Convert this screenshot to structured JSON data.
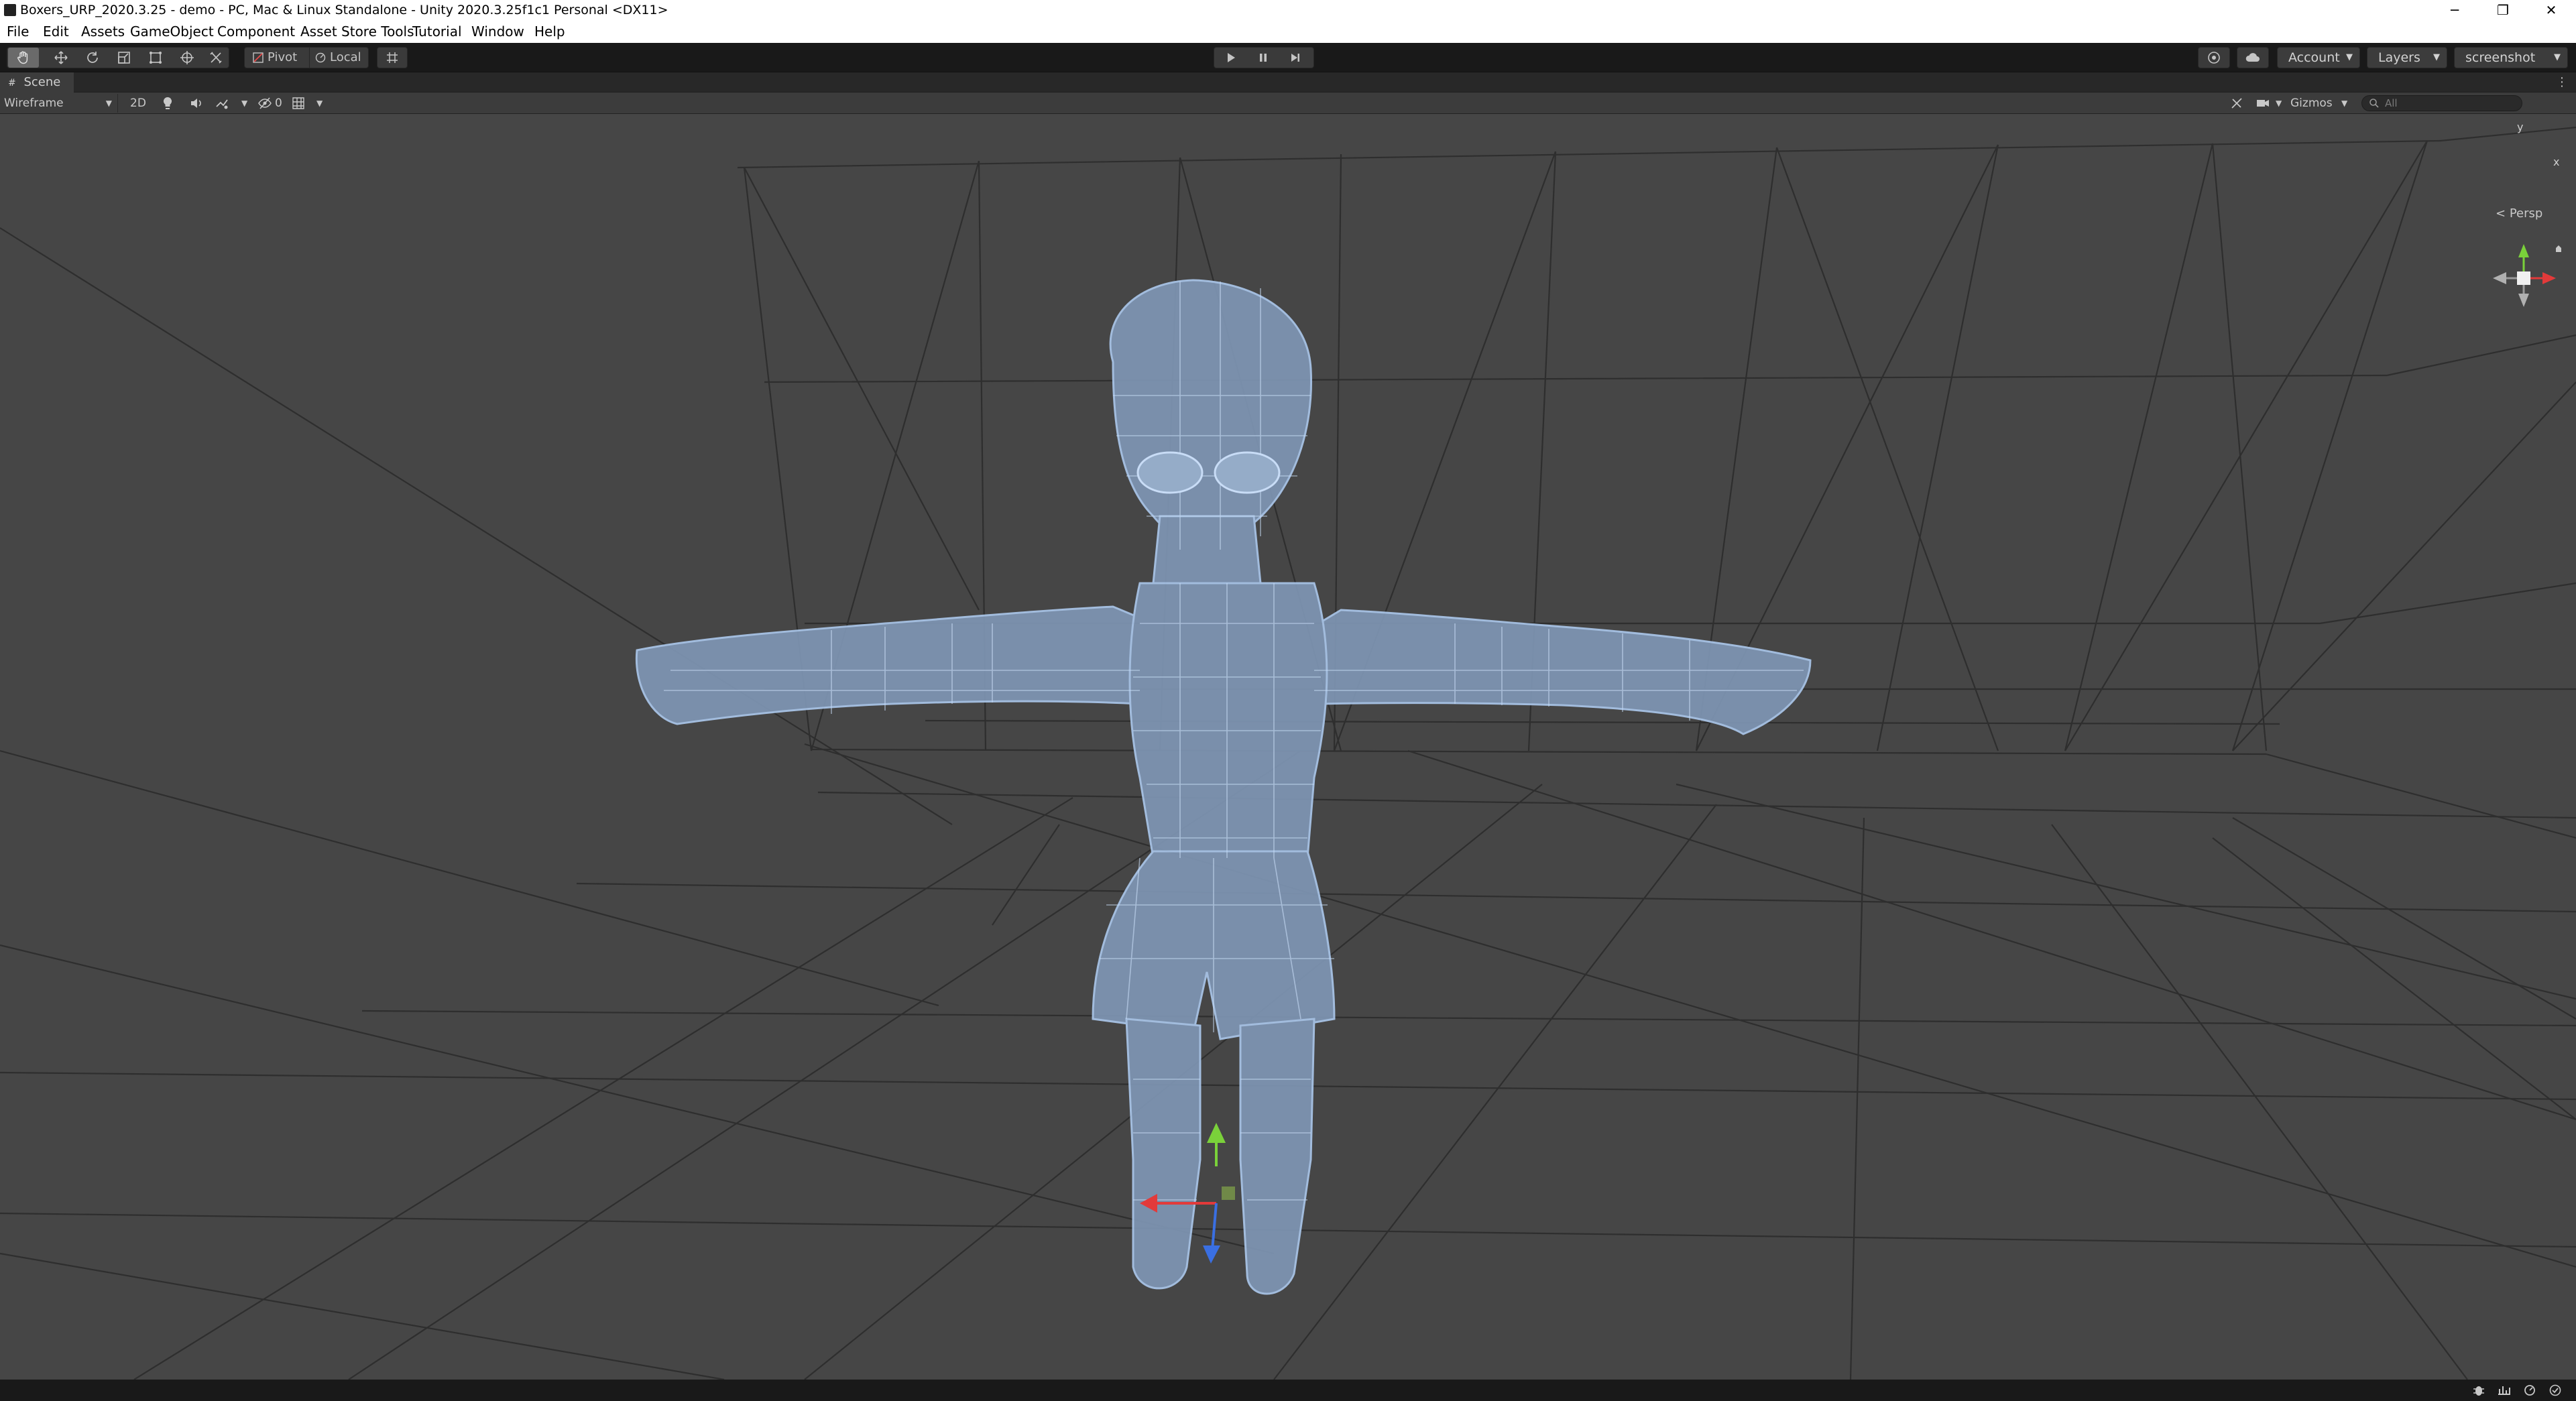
{
  "window": {
    "title": "Boxers_URP_2020.3.25 - demo - PC, Mac & Linux Standalone - Unity 2020.3.25f1c1 Personal <DX11>",
    "controls": {
      "minimize": "─",
      "maximize": "❐",
      "close": "✕"
    }
  },
  "menu": {
    "items": [
      "File",
      "Edit",
      "Assets",
      "GameObject",
      "Component",
      "Asset Store Tools",
      "Tutorial",
      "Window",
      "Help"
    ]
  },
  "toolbar": {
    "tools": [
      "hand-tool",
      "move-tool",
      "rotate-tool",
      "scale-tool",
      "rect-tool",
      "transform-tool",
      "custom-tool"
    ],
    "active_tool": "hand-tool",
    "pivot_label": "Pivot",
    "local_label": "Local",
    "play_controls": [
      "play",
      "pause",
      "step"
    ],
    "account_label": "Account",
    "layers_label": "Layers",
    "layout_label": "screenshot"
  },
  "scene_tab": {
    "label": "Scene"
  },
  "scene_toolbar": {
    "draw_mode": "Wireframe",
    "mode_2d": "2D",
    "hidden_count": "0",
    "gizmos_label": "Gizmos",
    "search_placeholder": "All"
  },
  "gizmo": {
    "y_label": "y",
    "x_label": "x",
    "projection": "Persp"
  },
  "colors": {
    "viewport_bg": "#464646",
    "grid_line": "#2c2c2c",
    "wireframe": "#a9c4e8",
    "axis_x": "#e23a3a",
    "axis_y": "#7ad13a",
    "axis_z": "#3a6fe2"
  }
}
